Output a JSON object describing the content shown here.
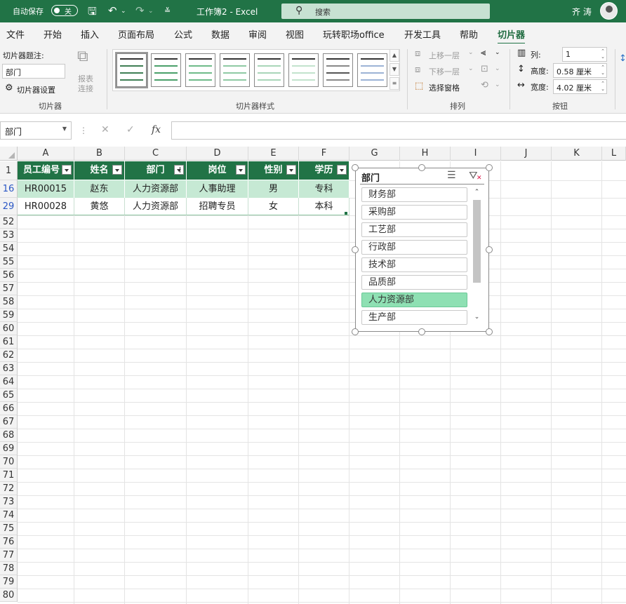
{
  "titlebar": {
    "autosave_label": "自动保存",
    "autosave_state": "关",
    "doc_title": "工作簿2 - Excel",
    "search_placeholder": "搜索",
    "user_name": "齐 涛"
  },
  "menu": {
    "tabs": [
      "文件",
      "开始",
      "插入",
      "页面布局",
      "公式",
      "数据",
      "审阅",
      "视图",
      "玩转职场office",
      "开发工具",
      "帮助",
      "切片器"
    ],
    "active_tab": "切片器"
  },
  "ribbon": {
    "slicer_group": {
      "caption_label": "切片器题注:",
      "caption_value": "部门",
      "settings_label": "切片器设置",
      "report_label1": "报表",
      "report_label2": "连接",
      "group_label": "切片器"
    },
    "styles_group": {
      "group_label": "切片器样式"
    },
    "arrange_group": {
      "bring_forward": "上移一层",
      "send_backward": "下移一层",
      "selection_pane": "选择窗格",
      "group_label": "排列"
    },
    "buttons_group": {
      "columns_label": "列:",
      "columns_value": "1",
      "height_label": "高度:",
      "height_value": "0.58 厘米",
      "width_label": "宽度:",
      "width_value": "4.02 厘米",
      "group_label": "按钮"
    }
  },
  "formula_bar": {
    "name_box": "部门",
    "cancel": "✕",
    "enter": "✓",
    "fx": "fx",
    "formula": ""
  },
  "grid": {
    "columns": [
      "A",
      "B",
      "C",
      "D",
      "E",
      "F",
      "G",
      "H",
      "I",
      "J",
      "K",
      "L"
    ],
    "header_row": "1",
    "table_headers": [
      "员工编号",
      "姓名",
      "部门",
      "岗位",
      "性别",
      "学历"
    ],
    "rows": [
      {
        "row": "16",
        "cells": [
          "HR00015",
          "赵东",
          "人力资源部",
          "人事助理",
          "男",
          "专科"
        ]
      },
      {
        "row": "29",
        "cells": [
          "HR00028",
          "黄悠",
          "人力资源部",
          "招聘专员",
          "女",
          "本科"
        ]
      }
    ],
    "empty_rows": [
      "52",
      "53",
      "54",
      "55",
      "56",
      "57",
      "58",
      "59",
      "60",
      "61",
      "62",
      "63",
      "64",
      "65",
      "66",
      "67",
      "68",
      "69",
      "70",
      "71",
      "72",
      "73",
      "74",
      "75",
      "76",
      "77",
      "78",
      "79",
      "80"
    ]
  },
  "slicer": {
    "title": "部门",
    "items": [
      "财务部",
      "采购部",
      "工艺部",
      "行政部",
      "技术部",
      "品质部",
      "人力资源部",
      "生产部"
    ],
    "selected": "人力资源部",
    "multi_select_icon": "multi-select-icon",
    "clear_filter_icon": "clear-filter-icon"
  },
  "colors": {
    "excel_green": "#217346",
    "table_band": "#c6e9d4",
    "slicer_selected": "#8ee0b3",
    "filtered_row_number": "#2b57c5"
  }
}
